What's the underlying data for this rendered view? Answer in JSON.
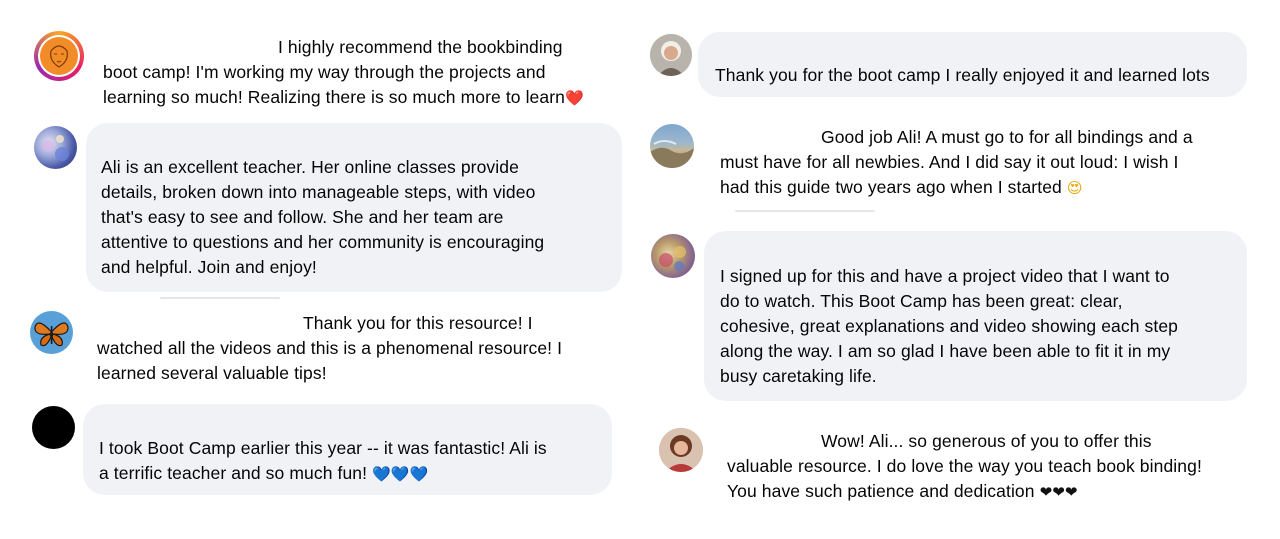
{
  "comments": [
    {
      "id": "c1",
      "avatar_icon": "orange-sketch-portrait-avatar",
      "lines": [
        "I highly recommend the bookbinding",
        "boot camp! I'm working my way through the projects and",
        "learning so much! Realizing there is so much more to learn"
      ],
      "end_emoji": "❤️"
    },
    {
      "id": "c2",
      "avatar_icon": "blue-floral-avatar",
      "lines": [
        "Ali is an excellent teacher. Her online classes provide",
        "details, broken down into manageable steps, with video",
        "that's easy to see and follow. She and her team are",
        "attentive to questions and her community is encouraging",
        "and helpful. Join and enjoy!"
      ]
    },
    {
      "id": "c3",
      "avatar_icon": "monarch-butterfly-avatar",
      "lines": [
        "Thank you for this resource! I",
        "watched all the videos and this is a phenomenal resource! I",
        "learned several valuable tips!"
      ]
    },
    {
      "id": "c4",
      "avatar_icon": "black-circle-avatar",
      "lines": [
        "I took Boot Camp earlier this year -- it was fantastic! Ali is",
        "a terrific teacher and so much fun!"
      ],
      "end_emoji": "💙💙💙"
    },
    {
      "id": "c5",
      "avatar_icon": "white-haired-person-avatar",
      "lines": [
        "Thank you for the boot camp I really enjoyed it and learned lots"
      ]
    },
    {
      "id": "c6",
      "avatar_icon": "landscape-photo-avatar",
      "lines": [
        "Good job Ali! A must go to for all bindings and a",
        "must have for all newbies. And I did say it out loud: I wish I",
        "had this guide two years ago when I started"
      ],
      "end_emoji": "😍"
    },
    {
      "id": "c7",
      "avatar_icon": "colorful-photo-avatar",
      "lines": [
        "I signed up for this and have a project video that I want to",
        "do to watch. This Boot Camp has been great: clear,",
        "cohesive, great explanations and video showing each step",
        "along the way. I am so glad I have been able to fit it in my",
        "busy caretaking life."
      ]
    },
    {
      "id": "c8",
      "avatar_icon": "woman-portrait-avatar",
      "lines": [
        "Wow! Ali... so generous of you to offer this",
        "valuable resource. I do love the way you teach book binding!",
        "You have such patience and dedication"
      ],
      "end_emoji": "❤❤❤"
    }
  ]
}
